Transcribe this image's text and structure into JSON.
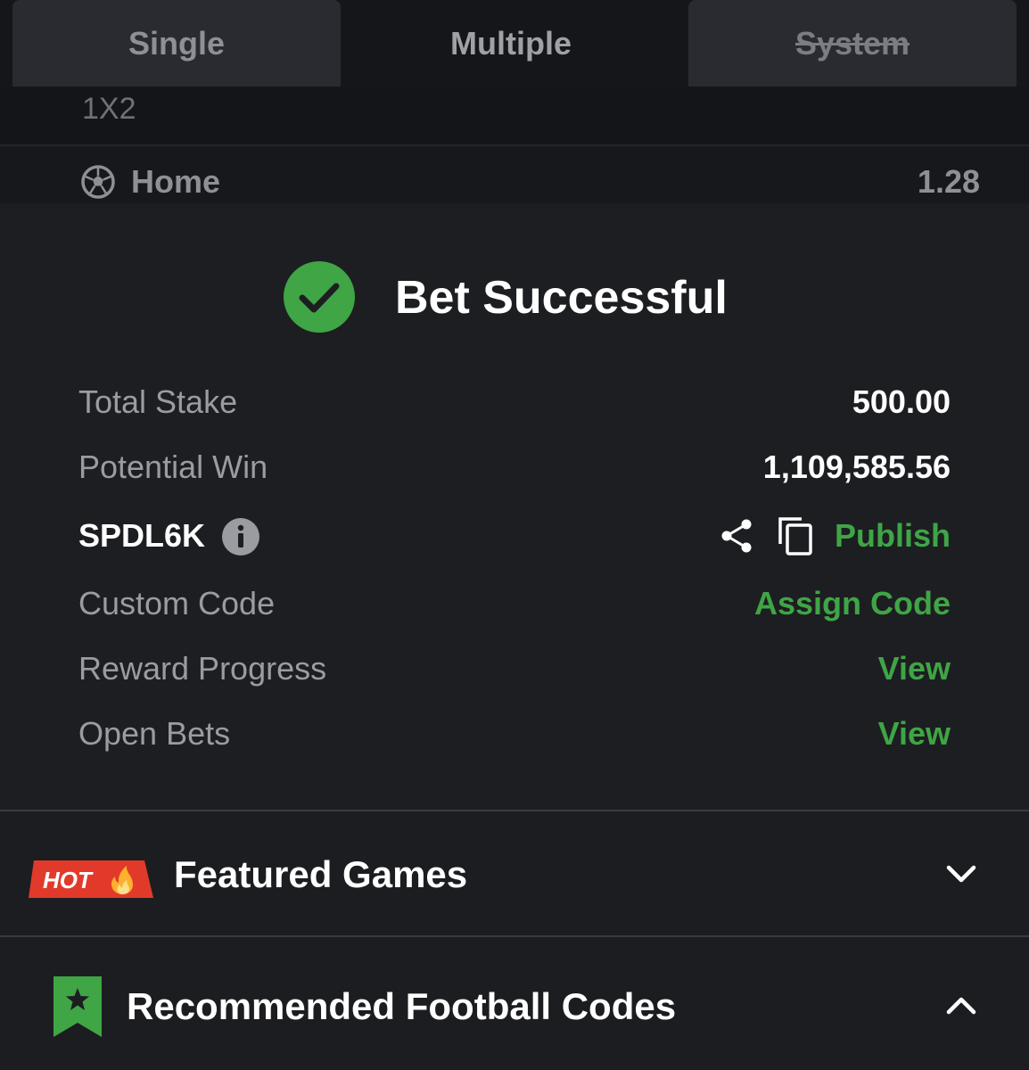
{
  "tabs": {
    "single": "Single",
    "multiple": "Multiple",
    "system": "System"
  },
  "betslip": {
    "market": "1X2",
    "selection": "Home",
    "odds": "1.28",
    "sport_icon": "soccer-ball-icon"
  },
  "success": {
    "title": "Bet Successful",
    "icon": "check-circle-icon",
    "accent_color": "#3fa545"
  },
  "details": {
    "total_stake_label": "Total Stake",
    "total_stake_value": "500.00",
    "potential_win_label": "Potential Win",
    "potential_win_value": "1,109,585.56",
    "booking_code": "SPDL6K",
    "publish_label": "Publish",
    "custom_code_label": "Custom Code",
    "assign_code_label": "Assign Code",
    "reward_progress_label": "Reward Progress",
    "reward_view_label": "View",
    "open_bets_label": "Open Bets",
    "open_bets_view_label": "View"
  },
  "featured": {
    "badge": "HOT",
    "title": "Featured Games"
  },
  "recommended": {
    "title": "Recommended Football Codes"
  }
}
